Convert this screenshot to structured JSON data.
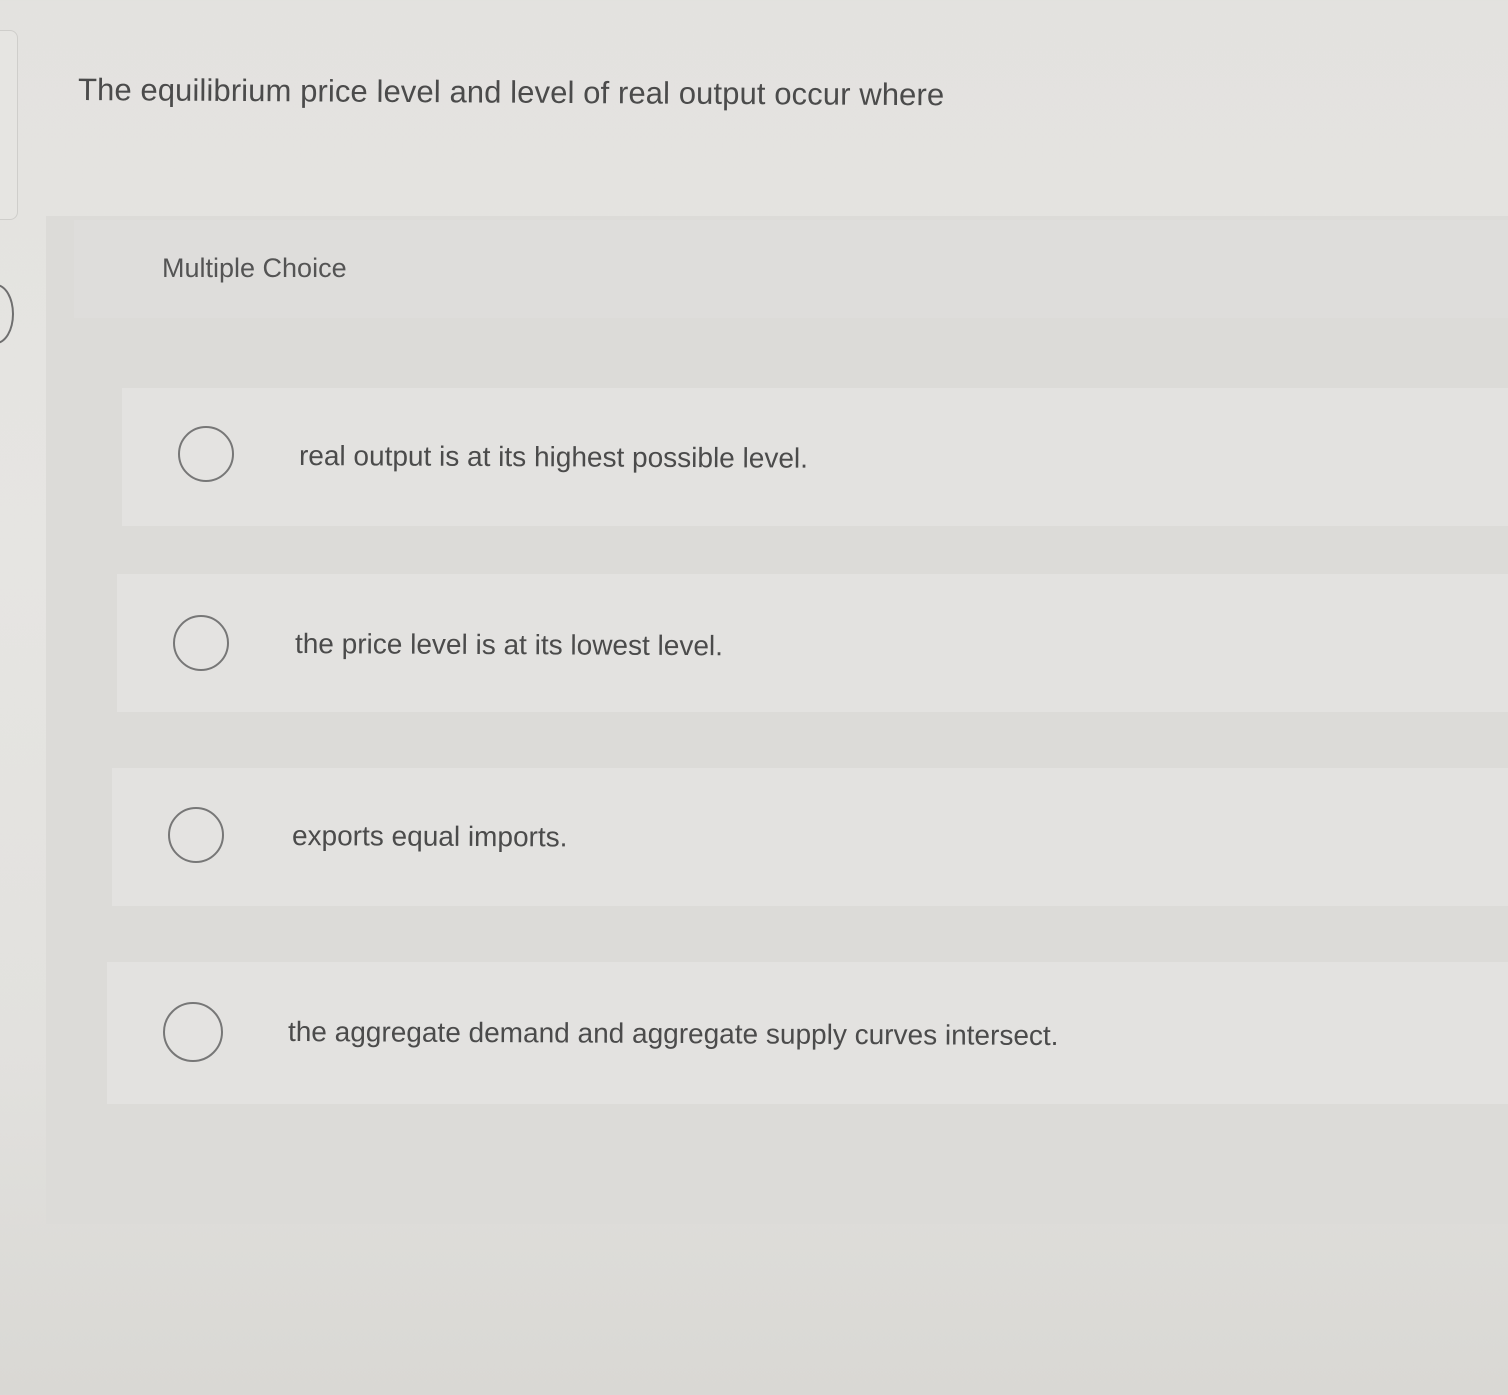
{
  "question": {
    "stem": "The equilibrium price level and level of real output occur where",
    "type_label": "Multiple Choice",
    "options": [
      {
        "label": "real output is at its highest possible level.",
        "selected": false
      },
      {
        "label": "the price level is at its lowest level.",
        "selected": false
      },
      {
        "label": "exports equal imports.",
        "selected": false
      },
      {
        "label": "the aggregate demand and aggregate supply curves intersect.",
        "selected": false
      }
    ]
  },
  "colors": {
    "page_background": "#e4e3e0",
    "panel_background": "#dcdbd8",
    "option_background": "#e3e2e0",
    "text": "#4b4b4b",
    "radio_border": "#777777"
  }
}
